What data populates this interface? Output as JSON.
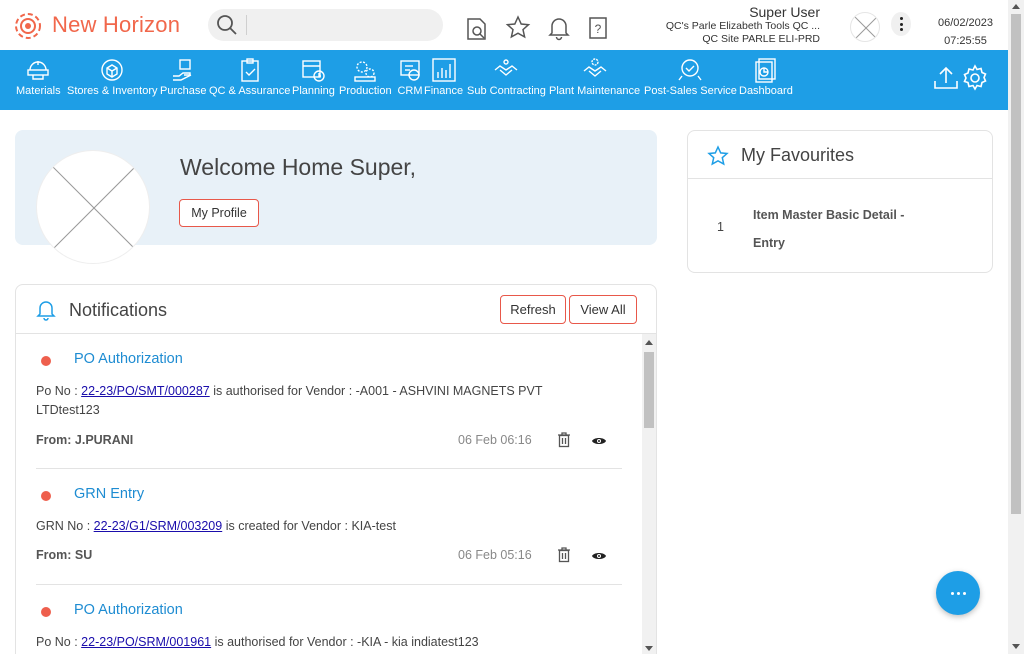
{
  "app": {
    "brand": "New Horizon"
  },
  "search": {
    "placeholder": ""
  },
  "user": {
    "name": "Super User",
    "company": "QC's Parle Elizabeth Tools QC ...",
    "site": "QC Site PARLE ELI-PRD"
  },
  "datetime": {
    "date": "06/02/2023",
    "time": "07:25:55"
  },
  "nav": {
    "items": [
      {
        "label": "Materials",
        "icon": "materials-icon"
      },
      {
        "label": "Stores & Inventory",
        "icon": "stores-inventory-icon"
      },
      {
        "label": "Purchase",
        "icon": "purchase-icon"
      },
      {
        "label": "QC & Assurance",
        "icon": "qc-assurance-icon"
      },
      {
        "label": "Planning",
        "icon": "planning-icon"
      },
      {
        "label": "Production",
        "icon": "production-icon"
      },
      {
        "label": "CRM",
        "icon": "crm-icon"
      },
      {
        "label": "Finance",
        "icon": "finance-icon"
      },
      {
        "label": "Sub Contracting",
        "icon": "sub-contracting-icon"
      },
      {
        "label": "Plant Maintenance",
        "icon": "plant-maintenance-icon"
      },
      {
        "label": "Post-Sales Service",
        "icon": "post-sales-service-icon"
      },
      {
        "label": "Dashboard",
        "icon": "dashboard-icon"
      }
    ]
  },
  "welcome": {
    "title": "Welcome Home Super,",
    "profile_button": "My Profile"
  },
  "notifications": {
    "title": "Notifications",
    "refresh_label": "Refresh",
    "view_all_label": "View All",
    "items": [
      {
        "title": "PO Authorization",
        "prefix": "Po No : ",
        "link": "22-23/PO/SMT/000287",
        "suffix_line1": " is authorised for Vendor : -A001 - ASHVINI MAGNETS PVT",
        "suffix_line2": "LTDtest123",
        "from_label": "From: ",
        "from": "J.PURANI",
        "time": "06 Feb 06:16"
      },
      {
        "title": "GRN Entry",
        "prefix": "GRN No : ",
        "link": "22-23/G1/SRM/003209",
        "suffix_line1": " is created for Vendor : KIA-test",
        "suffix_line2": "",
        "from_label": "From: ",
        "from": "SU",
        "time": "06 Feb 05:16"
      },
      {
        "title": "PO Authorization",
        "prefix": "Po No : ",
        "link": "22-23/PO/SRM/001961",
        "suffix_line1": " is authorised for Vendor : -KIA - kia indiatest123",
        "suffix_line2": "",
        "from_label": "",
        "from": "",
        "time": ""
      }
    ]
  },
  "favourites": {
    "title": "My Favourites",
    "items": [
      {
        "index": "1",
        "label_line1": "Item Master Basic Detail -",
        "label_line2": "Entry"
      }
    ]
  },
  "colors": {
    "brand": "#f1674b",
    "nav_bg": "#1e9ee6",
    "accent_red": "#e8584a",
    "link_blue": "#1e8cd2",
    "welcome_bg": "#e8f1f8"
  }
}
